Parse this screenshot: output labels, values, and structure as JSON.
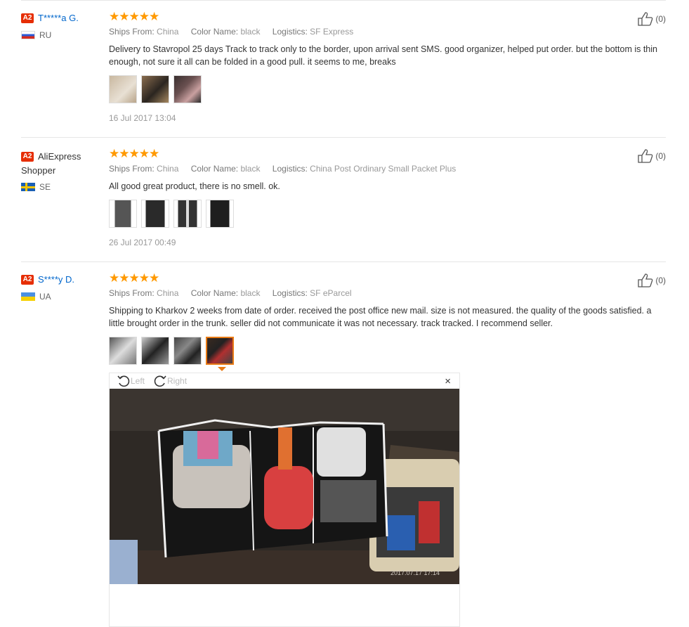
{
  "reviews": [
    {
      "badge": "A2",
      "name": "T*****a G.",
      "country": "RU",
      "stars": "★★★★★",
      "ships_from_label": "Ships From:",
      "ships_from": "China",
      "color_label": "Color Name:",
      "color": "black",
      "logistics_label": "Logistics:",
      "logistics": "SF Express",
      "text": "Delivery to Stavropol 25 days Track to track only to the border, upon arrival sent SMS. good organizer, helped put order. but the bottom is thin enough, not sure it all can be folded in a good pull. it seems to me, breaks",
      "date": "16 Jul 2017 13:04",
      "likes": "(0)"
    },
    {
      "badge": "A2",
      "name": "AliExpress Shopper",
      "country": "SE",
      "stars": "★★★★★",
      "ships_from_label": "Ships From:",
      "ships_from": "China",
      "color_label": "Color Name:",
      "color": "black",
      "logistics_label": "Logistics:",
      "logistics": "China Post Ordinary Small Packet Plus",
      "text": "All good great product, there is no smell. ok.",
      "date": "26 Jul 2017 00:49",
      "likes": "(0)"
    },
    {
      "badge": "A2",
      "name": "S****y D.",
      "country": "UA",
      "stars": "★★★★★",
      "ships_from_label": "Ships From:",
      "ships_from": "China",
      "color_label": "Color Name:",
      "color": "black",
      "logistics_label": "Logistics:",
      "logistics": "SF eParcel",
      "text": "Shipping to Kharkov 2 weeks from date of order. received the post office new mail. size is not measured. the quality of the goods satisfied. a little brought order in the trunk. seller did not communicate it was not necessary. track tracked. I recommend seller.",
      "likes": "(0)"
    }
  ],
  "viewer": {
    "rotate_left": "Left",
    "rotate_right": "Right",
    "close": "×",
    "photo_timestamp": "2017.07.17 17:14"
  },
  "colors": {
    "star": "#ff9900",
    "badge": "#e62e04",
    "link": "#0066cc",
    "active_thumb": "#e97b15"
  }
}
